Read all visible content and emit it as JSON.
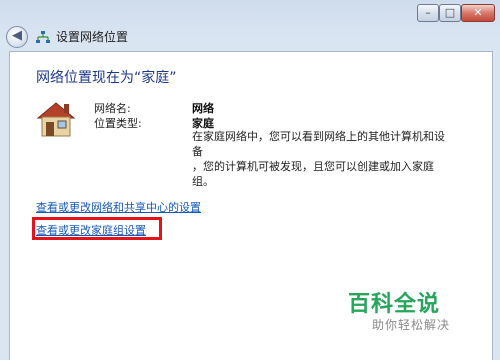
{
  "window": {
    "title": "设置网络位置",
    "controls": {
      "minimize": "–",
      "maximize": "□",
      "close": "✕"
    },
    "back_icon": "back-arrow-icon"
  },
  "main": {
    "heading": "网络位置现在为“家庭”",
    "network_name_label": "网络名:",
    "network_name_value": "网络",
    "location_type_label": "位置类型:",
    "location_type_value": "家庭",
    "description_line1": "在家庭网络中，您可以看到网络上的其他计算机和设备",
    "description_line2": "，您的计算机可被发现，且您可以创建或加入家庭组。",
    "icon": "house-icon"
  },
  "links": {
    "sharing_center": "查看或更改网络和共享中心的设置",
    "homegroup": "查看或更改家庭组设置"
  },
  "watermark": {
    "main": "百科全说",
    "sub": "助你轻松解决"
  },
  "colors": {
    "heading": "#1e3a8a",
    "link": "#1559b8",
    "highlight": "#e3131b",
    "watermark": "#26a65b"
  }
}
